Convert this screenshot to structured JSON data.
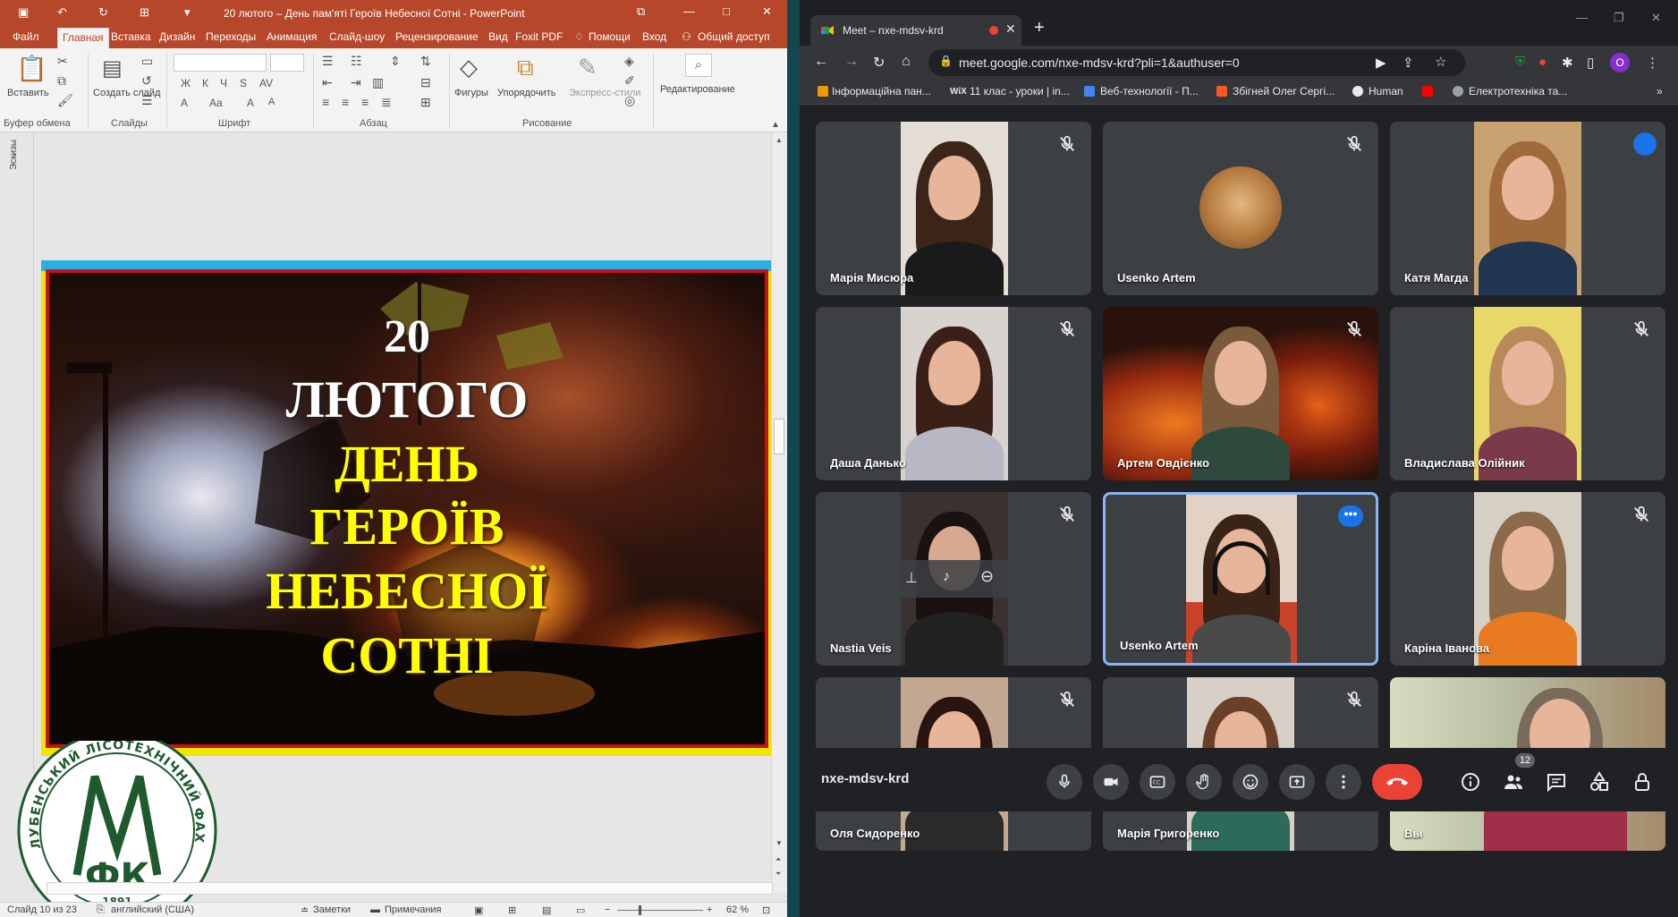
{
  "powerpoint": {
    "window_title": "20 лютого – День пам'яті Героїв Небесної Сотні - PowerPoint",
    "tabs": [
      "Файл",
      "Главная",
      "Вставка",
      "Дизайн",
      "Переходы",
      "Анимация",
      "Слайд-шоу",
      "Рецензирование",
      "Вид",
      "Foxit PDF"
    ],
    "active_tab": "Главная",
    "help_label": "Помощи",
    "signin_label": "Вход",
    "share_label": "Общий доступ",
    "ribbon": {
      "paste_label": "Вставить",
      "new_slide_label": "Создать слайд",
      "shapes_label": "Фигуры",
      "arrange_label": "Упорядочить",
      "quick_styles_label": "Экспресс-стили",
      "editing_label": "Редактирование",
      "groups": [
        "Буфер обмена",
        "Слайды",
        "Шрифт",
        "Абзац",
        "Рисование"
      ]
    },
    "sketches_label": "Эскизы",
    "slide": {
      "line1": "20",
      "line2": "ЛЮТОГО",
      "line3": "ДЕНЬ",
      "line4": "ГЕРОЇВ",
      "line5": "НЕБЕСНОЇ",
      "line6": "СОТНІ"
    },
    "logo": {
      "ring_text": "ЛУБЕНСЬКИЙ ЛІСОТЕХНІЧНИЙ ФАХОВИЙ КОЛЕДЖ",
      "monogram": "ЛФК",
      "year": "1891"
    },
    "status": {
      "slide_info": "Слайд 10 из 23",
      "language": "английский (США)",
      "notes_label": "Заметки",
      "comments_label": "Примечания",
      "zoom": "62 %"
    }
  },
  "chrome": {
    "tab_title": "Meet – nxe-mdsv-krd",
    "url": "meet.google.com/nxe-mdsv-krd?pli=1&authuser=0",
    "profile_initial": "O",
    "bookmarks": [
      "Інформаційна пан...",
      "11 клас - уроки | in...",
      "Веб-технології - П...",
      "Збігней Олег Сергі...",
      "Human",
      "Електротехніка та..."
    ],
    "bookmarks_overflow": "»"
  },
  "meet": {
    "participants": [
      {
        "name": "Марія Мисюра",
        "muted": true
      },
      {
        "name": "Usenko Artem",
        "muted": true
      },
      {
        "name": "Катя Магда",
        "muted": false
      },
      {
        "name": "Даша Данько",
        "muted": true
      },
      {
        "name": "Артем Овдієнко",
        "muted": true
      },
      {
        "name": "Владислава Олійник",
        "muted": true
      },
      {
        "name": "Nastia Veis",
        "muted": true
      },
      {
        "name": "Usenko Artem",
        "muted": false
      },
      {
        "name": "Каріна Іванова",
        "muted": true
      },
      {
        "name": "Оля Сидоренко",
        "muted": true
      },
      {
        "name": "Марія Григоренко",
        "muted": true
      },
      {
        "name": "Вы",
        "muted": false
      }
    ],
    "meeting_code": "nxe-mdsv-krd",
    "people_count": "12",
    "colors": {
      "end_call": "#ea4335",
      "accent": "#1a73e8",
      "tile_bg": "#3c4043"
    }
  }
}
